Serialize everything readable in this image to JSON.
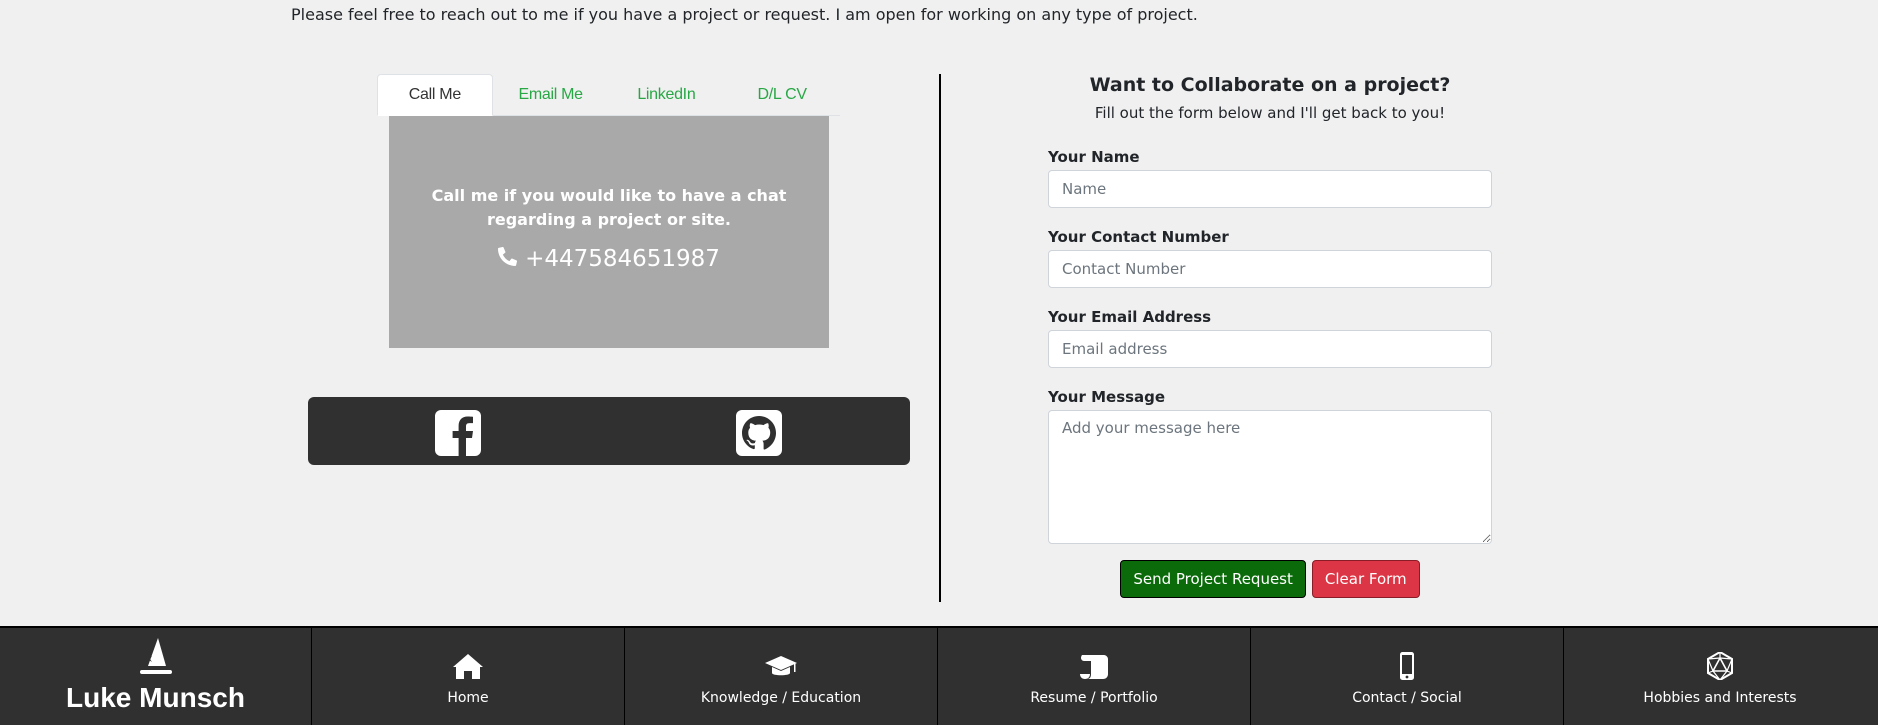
{
  "intro_text": "Please feel free to reach out to me if you have a project or request. I am open for working on any type of project.",
  "tabs": [
    {
      "label": "Call Me",
      "active": true
    },
    {
      "label": "Email Me",
      "active": false
    },
    {
      "label": "LinkedIn",
      "active": false
    },
    {
      "label": "D/L CV",
      "active": false
    }
  ],
  "call_panel": {
    "text": "Call me if you would like to have a chat regarding a project or site.",
    "phone_icon": "phone-icon",
    "phone": "+447584651987"
  },
  "social": [
    {
      "icon": "facebook-icon"
    },
    {
      "icon": "github-icon"
    }
  ],
  "form": {
    "title": "Want to Collaborate on a project?",
    "subtitle": "Fill out the form below and I'll get back to you!",
    "name_label": "Your Name",
    "name_placeholder": "Name",
    "contact_label": "Your Contact Number",
    "contact_placeholder": "Contact Number",
    "email_label": "Your Email Address",
    "email_placeholder": "Email address",
    "message_label": "Your Message",
    "message_placeholder": "Add your message here",
    "send_label": "Send Project Request",
    "clear_label": "Clear Form"
  },
  "footer": {
    "brand_icon": "wizard-hat-icon",
    "brand_name": "Luke Munsch",
    "nav": [
      {
        "label": "Home",
        "icon": "home-icon"
      },
      {
        "label": "Knowledge / Education",
        "icon": "graduation-cap-icon"
      },
      {
        "label": "Resume / Portfolio",
        "icon": "scroll-icon"
      },
      {
        "label": "Contact / Social",
        "icon": "mobile-phone-icon"
      },
      {
        "label": "Hobbies and Interests",
        "icon": "d20-dice-icon"
      }
    ]
  },
  "colors": {
    "background": "#f0f0f0",
    "tab_link": "#28a745",
    "panel": "#a9a9a9",
    "dark_bar": "#303030",
    "send_button": "#0b6b0b",
    "clear_button": "#dc3545"
  }
}
